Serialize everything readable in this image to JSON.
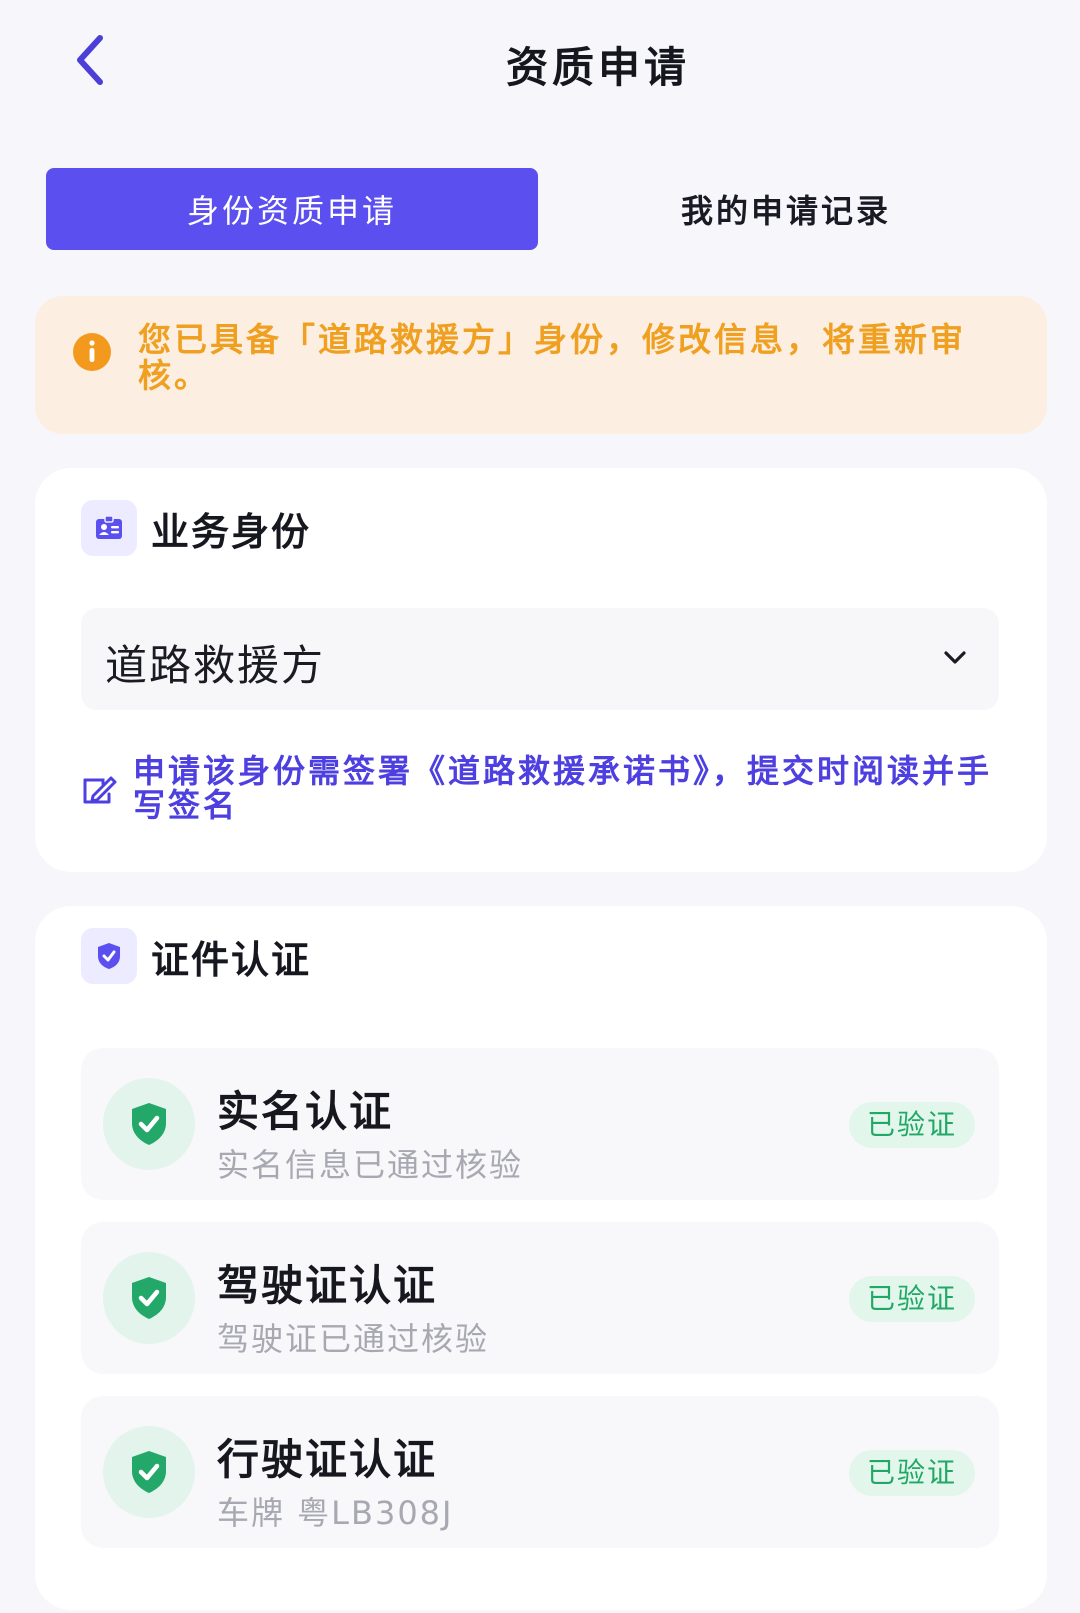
{
  "header": {
    "title": "资质申请"
  },
  "tabs": [
    {
      "label": "身份资质申请",
      "active": true
    },
    {
      "label": "我的申请记录",
      "active": false
    }
  ],
  "notice": {
    "text": "您已具备「道路救援方」身份，修改信息，将重新审核。",
    "icon": "info-icon",
    "color": "#f0a020"
  },
  "identity_section": {
    "title": "业务身份",
    "icon": "id-card-icon",
    "select_value": "道路救援方",
    "hint_icon": "sign-document-icon",
    "hint_text": "申请该身份需签署《道路救援承诺书》，提交时阅读并手写签名"
  },
  "cert_section": {
    "title": "证件认证",
    "icon": "shield-check-icon",
    "items": [
      {
        "title": "实名认证",
        "subtitle": "实名信息已通过核验",
        "status": "已验证"
      },
      {
        "title": "驾驶证认证",
        "subtitle": "驾驶证已通过核验",
        "status": "已验证"
      },
      {
        "title": "行驶证认证",
        "subtitle": "车牌 粤LB308J",
        "status": "已验证"
      }
    ]
  },
  "colors": {
    "accent": "#5b4ff0",
    "verified": "#22a866",
    "warning": "#f0a020"
  }
}
